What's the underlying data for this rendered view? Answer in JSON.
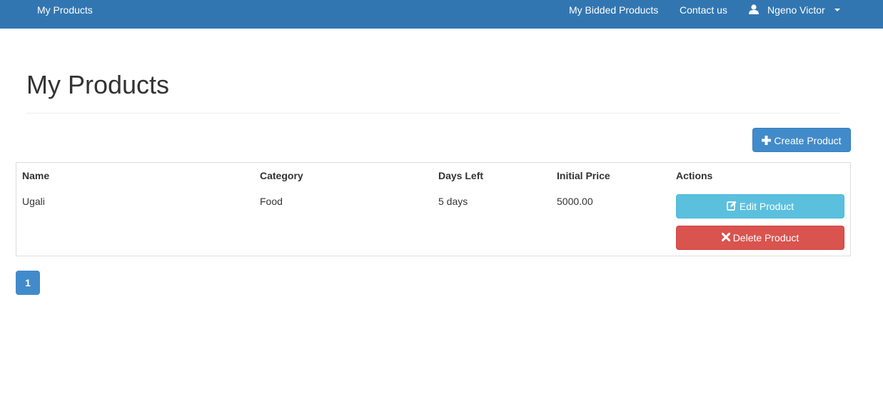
{
  "navbar": {
    "brand": "My Products",
    "links": {
      "bidded": "My Bidded Products",
      "contact": "Contact us"
    },
    "user": {
      "name": "Ngeno Victor",
      "icon": "user-icon"
    },
    "background": "#3276b1"
  },
  "page": {
    "title": "My Products"
  },
  "toolbar": {
    "create_label": "Create Product",
    "create_icon": "plus-icon"
  },
  "table": {
    "headers": {
      "name": "Name",
      "category": "Category",
      "days_left": "Days Left",
      "initial_price": "Initial Price",
      "actions": "Actions"
    },
    "rows": [
      {
        "name": "Ugali",
        "category": "Food",
        "days_left": "5 days",
        "initial_price": "5000.00",
        "edit_label": "Edit Product",
        "delete_label": "Delete Product"
      }
    ]
  },
  "pagination": {
    "pages": [
      "1"
    ],
    "current": "1"
  },
  "colors": {
    "primary": "#428bca",
    "info": "#5bc0de",
    "danger": "#d9534f"
  }
}
